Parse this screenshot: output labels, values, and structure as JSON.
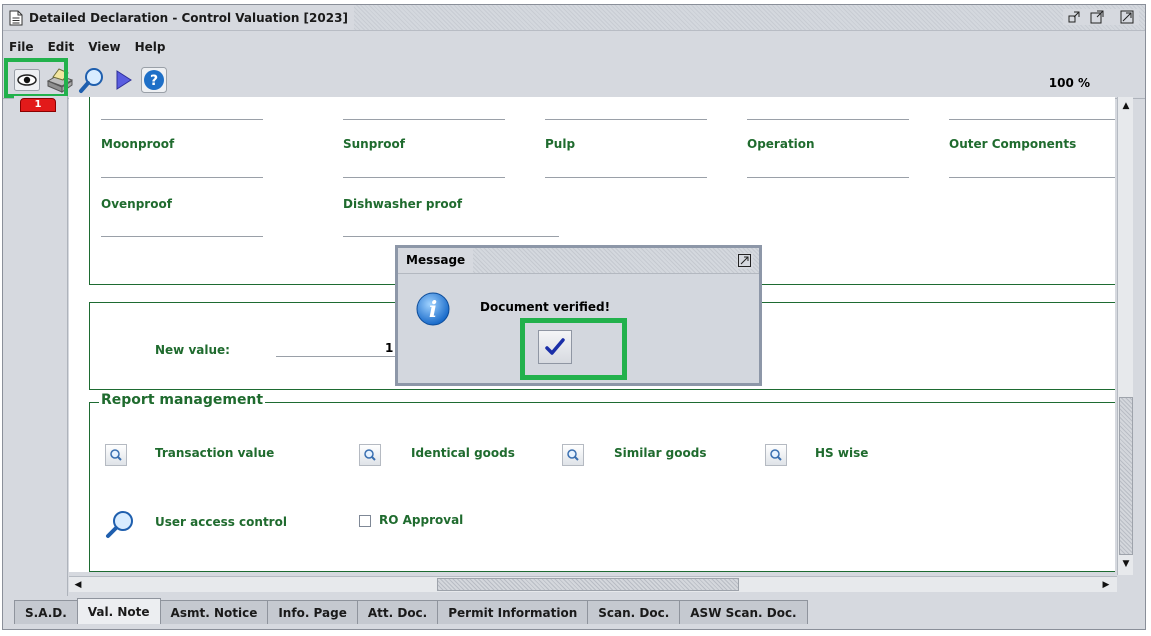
{
  "window": {
    "title": "Detailed Declaration - Control Valuation [2023]"
  },
  "menu": [
    "File",
    "Edit",
    "View",
    "Help"
  ],
  "toolbar": {
    "buttons": [
      {
        "name": "view-eye-icon"
      },
      {
        "name": "print-icon"
      },
      {
        "name": "search-icon"
      },
      {
        "name": "play-icon"
      },
      {
        "name": "help-icon"
      }
    ],
    "zoom": "100 %"
  },
  "page_tag": "1",
  "fields": {
    "row1": [
      "Moonproof",
      "Sunproof",
      "Pulp",
      "Operation",
      "Outer Components"
    ],
    "row2": [
      "Ovenproof",
      "Dishwasher proof"
    ]
  },
  "new_value": {
    "label": "New value:",
    "value": "1"
  },
  "report_management": {
    "title": "Report management",
    "buttons": [
      "Transaction value",
      "Identical goods",
      "Similar goods",
      "HS wise"
    ],
    "user_access": "User access control",
    "ro_approval": "RO Approval"
  },
  "tabs": [
    "S.A.D.",
    "Val. Note",
    "Asmt. Notice",
    "Info. Page",
    "Att. Doc.",
    "Permit Information",
    "Scan. Doc.",
    "ASW Scan. Doc."
  ],
  "active_tab": "Val. Note",
  "dialog": {
    "title": "Message",
    "message": "Document verified!"
  },
  "colors": {
    "label_green": "#1f6b2e",
    "highlight": "#22b14c",
    "page_tag": "#e21a1a"
  }
}
